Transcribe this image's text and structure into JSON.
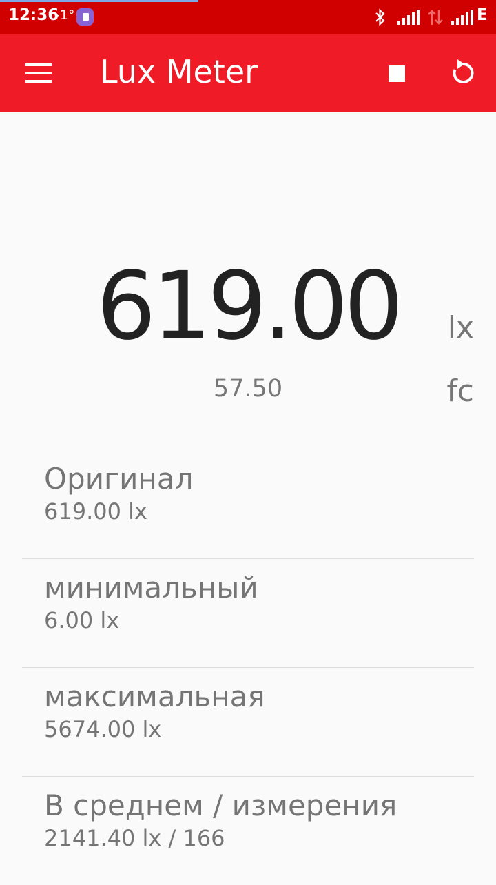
{
  "status_bar": {
    "time": "12:36",
    "temperature": "-1°",
    "network_label": "E",
    "icons": [
      "app-notification-icon",
      "bluetooth-icon",
      "signal-icon",
      "data-transfer-icon",
      "signal-icon"
    ],
    "background_color": "#d10000"
  },
  "app_bar": {
    "title": "Lux Meter",
    "background_color": "#ef1c28",
    "icons": [
      "menu-icon",
      "stop-icon",
      "refresh-icon"
    ]
  },
  "reading": {
    "value": "619.00",
    "unit": "lx",
    "secondary_value": "57.50",
    "secondary_unit": "fc"
  },
  "stats": [
    {
      "label": "Оригинал",
      "value": "619.00 lx"
    },
    {
      "label": "минимальный",
      "value": "6.00 lx"
    },
    {
      "label": "максимальная",
      "value": "5674.00 lx"
    },
    {
      "label": "В среднем / измерения",
      "value": "2141.40 lx / 166"
    }
  ]
}
